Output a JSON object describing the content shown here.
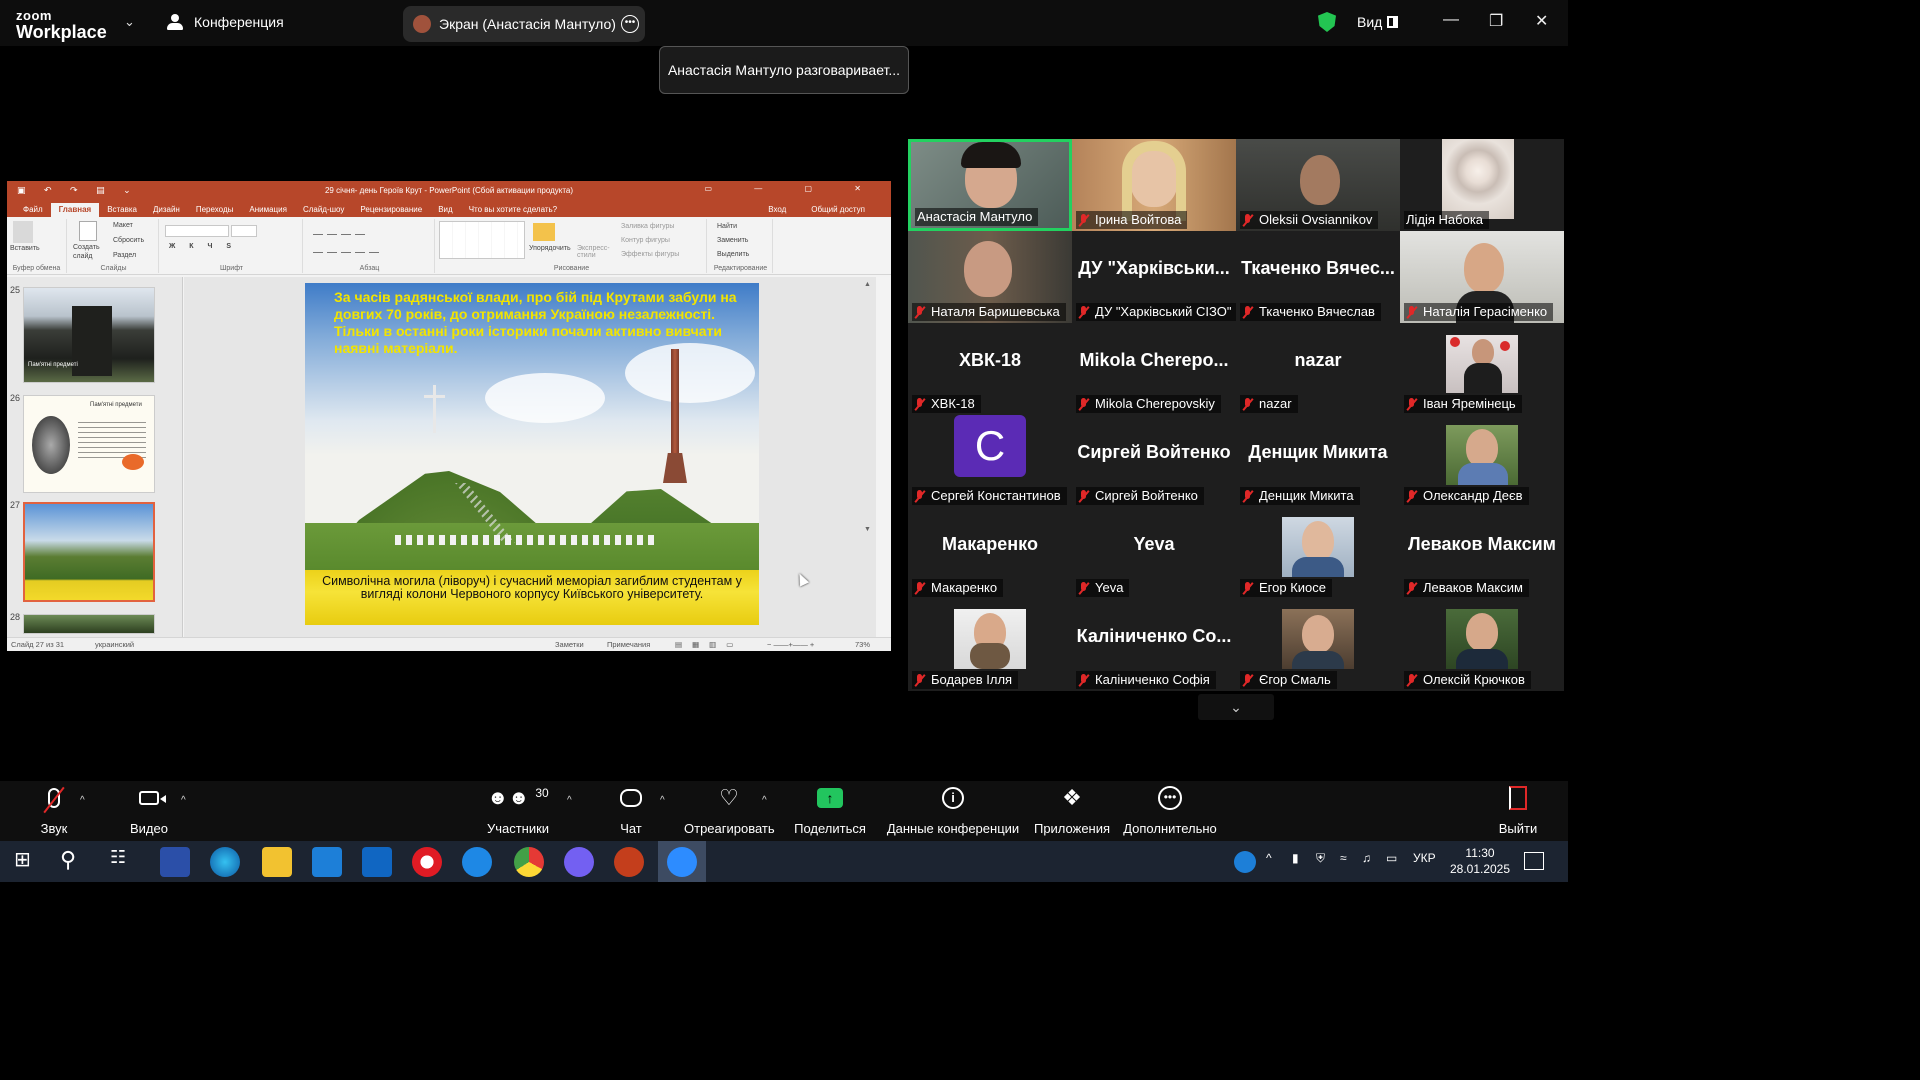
{
  "app": {
    "logo_line1": "zoom",
    "logo_line2": "Workplace",
    "conference_label": "Конференция",
    "screen_share_label": "Экран (Анастасія Мантуло)",
    "view_label": "Вид",
    "speaking_toast": "Анастасія Мантуло разговаривает..."
  },
  "ppt": {
    "window_title": "29 січня- день Героїв Крут - PowerPoint (Сбой активации продукта)",
    "tabs": [
      "Файл",
      "Главная",
      "Вставка",
      "Дизайн",
      "Переходы",
      "Анимация",
      "Слайд-шоу",
      "Рецензирование",
      "Вид"
    ],
    "active_tab": "Главная",
    "tell_me": "Что вы хотите сделать?",
    "signin": "Вход",
    "share": "Общий доступ",
    "ribbon": {
      "paste": "Вставить",
      "clipboard_group": "Буфер обмена",
      "new_slide": "Создать слайд",
      "layout": "Макет",
      "reset": "Сбросить",
      "section": "Раздел",
      "slides_group": "Слайды",
      "font_group": "Шрифт",
      "paragraph_group": "Абзац",
      "arrange": "Упорядочить",
      "quick_styles": "Экспресс-стили",
      "shape_fill": "Заливка фигуры",
      "shape_outline": "Контур фигуры",
      "shape_effects": "Эффекты фигуры",
      "drawing_group": "Рисование",
      "find": "Найти",
      "replace": "Заменить",
      "select": "Выделить",
      "editing_group": "Редактирование"
    },
    "thumb_numbers": [
      "25",
      "26",
      "27",
      "28"
    ],
    "thumb25_caption": "Пам'ятні предметі",
    "thumb26_title": "Пам'ятні предмети",
    "slide": {
      "heading": "За часів радянської влади, про бій під Крутами забули на довгих 70 років, до отримання Україною незалежності. Тільки в останні роки історики почали активно вивчати наявні матеріали.",
      "caption": "Символічна могила (ліворуч) і сучасний меморіал загиблим студентам у вигляді колони Червоного корпусу Київського університету."
    },
    "status": {
      "slide_counter": "Слайд 27 из 31",
      "language": "украинский",
      "notes": "Заметки",
      "comments": "Примечания",
      "zoom": "73%"
    }
  },
  "participants": [
    {
      "name": "Анастасія Мантуло",
      "big": "",
      "muted": false,
      "kind": "video",
      "active": true
    },
    {
      "name": "Ірина Войтова",
      "big": "",
      "muted": true,
      "kind": "video"
    },
    {
      "name": "Oleksii Ovsiannikov",
      "big": "",
      "muted": true,
      "kind": "video"
    },
    {
      "name": "Лідія Набока",
      "big": "",
      "muted": false,
      "kind": "video"
    },
    {
      "name": "Наталя Баришевська",
      "big": "",
      "muted": true,
      "kind": "video"
    },
    {
      "name": "ДУ \"Харківський СІЗО\"",
      "big": "ДУ \"Харківськи...",
      "muted": true,
      "kind": "text"
    },
    {
      "name": "Ткаченко Вячеслав",
      "big": "Ткаченко Вячес...",
      "muted": true,
      "kind": "text"
    },
    {
      "name": "Наталія Герасіменко",
      "big": "",
      "muted": true,
      "kind": "video"
    },
    {
      "name": "ХВК-18",
      "big": "ХВК-18",
      "muted": true,
      "kind": "text"
    },
    {
      "name": "Mikola Cherepovskiy",
      "big": "Mikola Cherepo...",
      "muted": true,
      "kind": "text"
    },
    {
      "name": "nazar",
      "big": "nazar",
      "muted": true,
      "kind": "text"
    },
    {
      "name": "Іван Яремінець",
      "big": "",
      "muted": true,
      "kind": "photo"
    },
    {
      "name": "Сергей Константинов",
      "big": "C",
      "muted": true,
      "kind": "avatar"
    },
    {
      "name": "Сиргей Войтенко",
      "big": "Сиргей Войтенко",
      "muted": true,
      "kind": "text"
    },
    {
      "name": "Денщик Микита",
      "big": "Денщик Микита",
      "muted": true,
      "kind": "text"
    },
    {
      "name": "Олександр Деєв",
      "big": "",
      "muted": true,
      "kind": "photo"
    },
    {
      "name": "Макаренко",
      "big": "Макаренко",
      "muted": true,
      "kind": "text"
    },
    {
      "name": "Yeva",
      "big": "Yeva",
      "muted": true,
      "kind": "text"
    },
    {
      "name": "Егор Киосе",
      "big": "",
      "muted": true,
      "kind": "photo"
    },
    {
      "name": "Левакoв Максим",
      "big": "Левакoв Максим",
      "muted": true,
      "kind": "text"
    },
    {
      "name": "Бодарев Ілля",
      "big": "",
      "muted": true,
      "kind": "photo"
    },
    {
      "name": "Каліниченко Софія",
      "big": "Каліниченко Со...",
      "muted": true,
      "kind": "text"
    },
    {
      "name": "Єгор Смаль",
      "big": "",
      "muted": true,
      "kind": "photo"
    },
    {
      "name": "Олексій Крючков",
      "big": "",
      "muted": true,
      "kind": "photo"
    }
  ],
  "toolbar": {
    "audio": "Звук",
    "video": "Видео",
    "participants": "Участники",
    "participants_count": "30",
    "chat": "Чат",
    "react": "Отреагировать",
    "share": "Поделиться",
    "meeting_info": "Данные конференции",
    "apps": "Приложения",
    "more": "Дополнительно",
    "leave": "Выйти"
  },
  "taskbar": {
    "lang": "УКР",
    "time": "11:30",
    "date": "28.01.2025"
  }
}
